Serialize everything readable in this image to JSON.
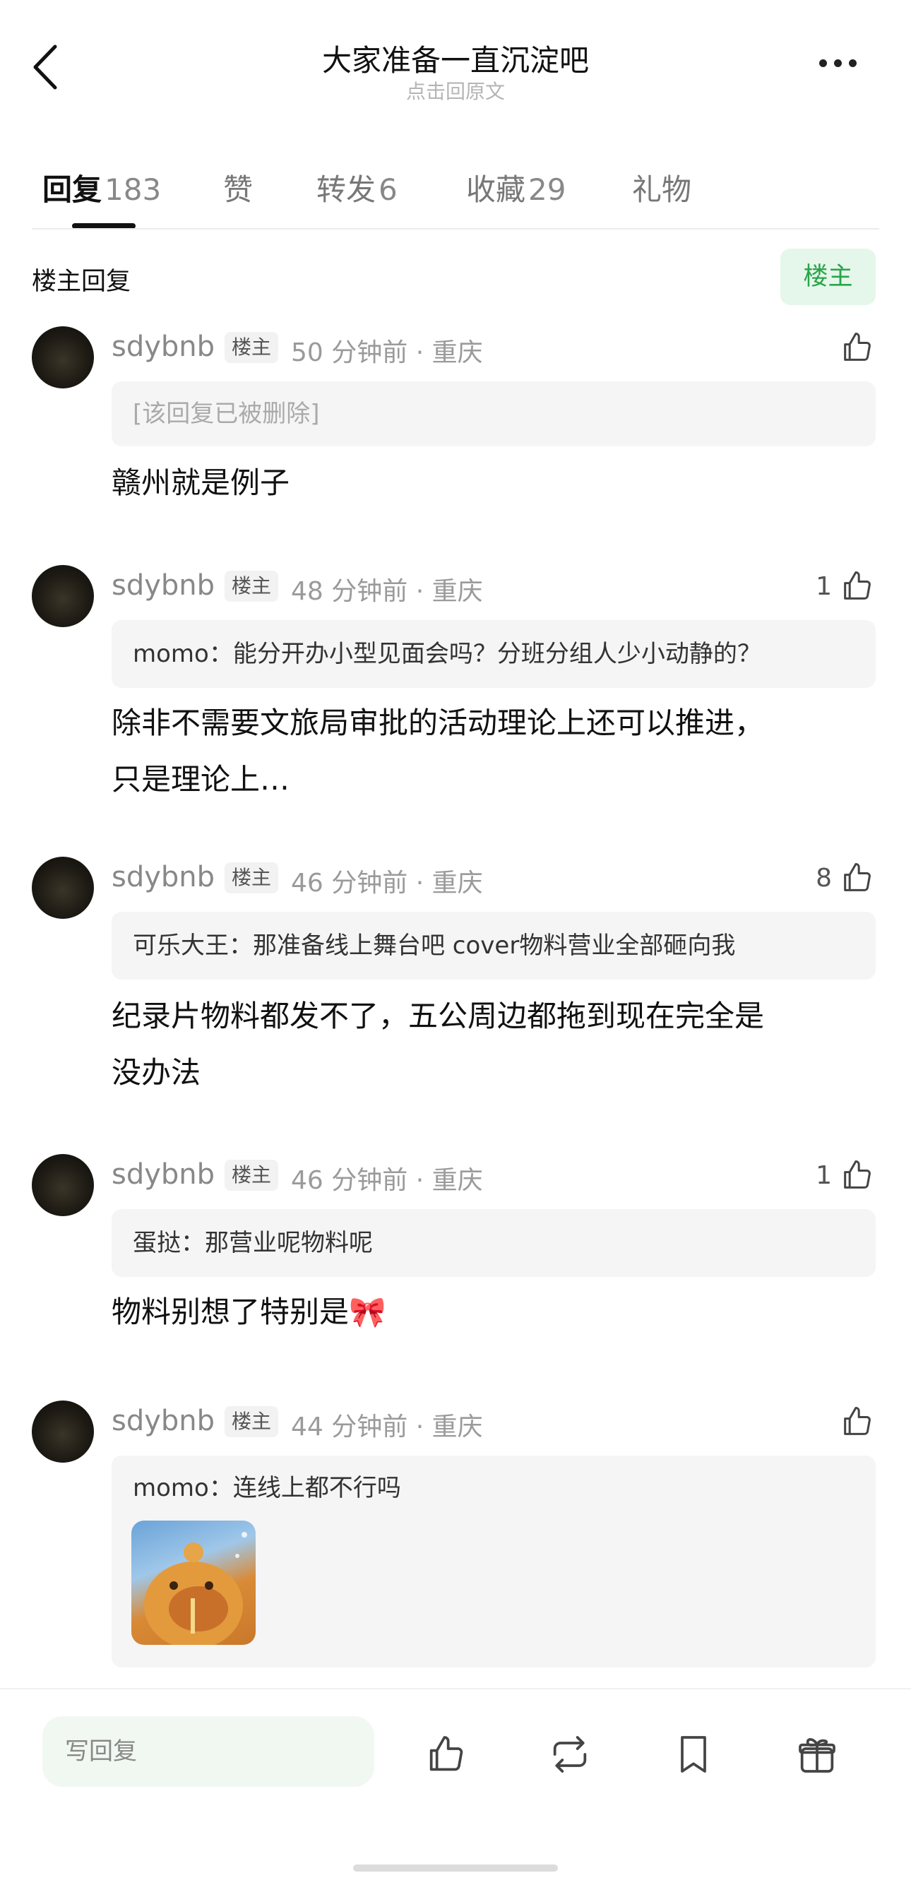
{
  "header": {
    "title": "大家准备一直沉淀吧",
    "subtitle": "点击回原文"
  },
  "tabs": [
    {
      "label": "回复",
      "count": "183",
      "active": true
    },
    {
      "label": "赞",
      "count": ""
    },
    {
      "label": "转发",
      "count": "6"
    },
    {
      "label": "收藏",
      "count": "29"
    },
    {
      "label": "礼物",
      "count": ""
    }
  ],
  "section": {
    "title": "楼主回复",
    "filter_label": "楼主"
  },
  "comments": [
    {
      "user": "sdybnb",
      "badge": "楼主",
      "meta": "50 分钟前 · 重庆",
      "likes": "",
      "quote": "[该回复已被删除]",
      "text": [
        "赣州就是例子"
      ]
    },
    {
      "user": "sdybnb",
      "badge": "楼主",
      "meta": "48 分钟前 · 重庆",
      "likes": "1",
      "quote": "momo：能分开办小型见面会吗？分班分组人少小动静的？",
      "text": [
        "除非不需要文旅局审批的活动理论上还可以推进，",
        "只是理论上…"
      ]
    },
    {
      "user": "sdybnb",
      "badge": "楼主",
      "meta": "46 分钟前 · 重庆",
      "likes": "8",
      "quote": "可乐大王：那准备线上舞台吧 cover物料营业全部砸向我",
      "text": [
        "纪录片物料都发不了，五公周边都拖到现在完全是",
        "没办法"
      ]
    },
    {
      "user": "sdybnb",
      "badge": "楼主",
      "meta": "46 分钟前 · 重庆",
      "likes": "1",
      "quote": "蛋挞：那营业呢物料呢",
      "text": [
        "物料别想了特别是🎀"
      ]
    },
    {
      "user": "sdybnb",
      "badge": "楼主",
      "meta": "44 分钟前 · 重庆",
      "likes": "",
      "quote": "momo：连线上都不行吗",
      "text": []
    }
  ],
  "bottom_bar": {
    "reply_placeholder": "写回复"
  },
  "colors": {
    "accent_green": "#2aa44a",
    "badge_bg": "#e5f7ea",
    "quote_bg": "#f5f5f5"
  }
}
